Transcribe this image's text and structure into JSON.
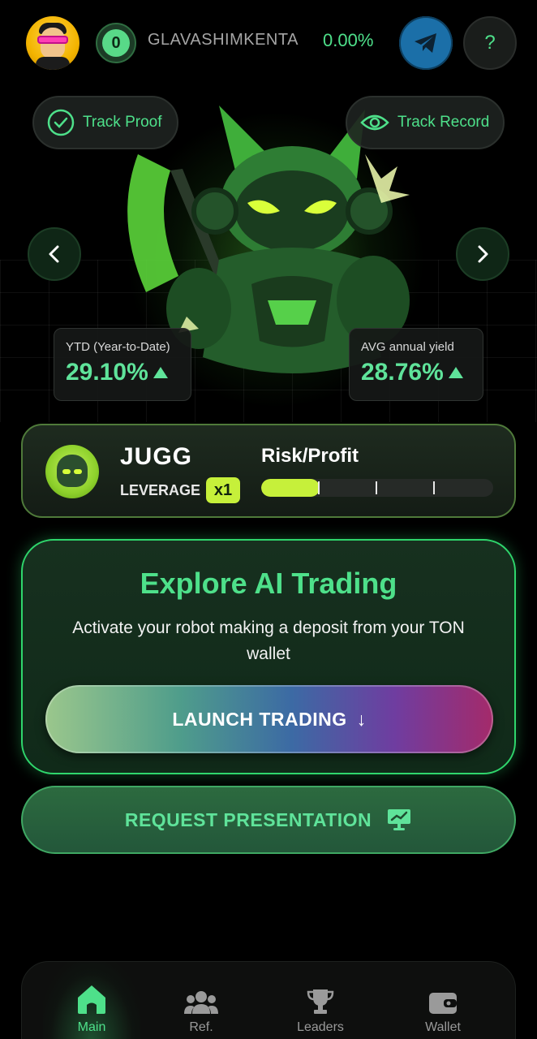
{
  "header": {
    "level": "0",
    "username": "GLAVASHIMKENTA",
    "pnl": "0.00%",
    "icons": {
      "avatar": "user-avatar",
      "telegram": "telegram-icon",
      "help": "help-icon"
    },
    "help_label": "?"
  },
  "hero": {
    "track_proof": "Track Proof",
    "track_record": "Track Record",
    "ytd_label": "YTD (Year-to-Date)",
    "ytd_value": "29.10%",
    "avg_label": "AVG annual yield",
    "avg_value": "28.76%"
  },
  "bot": {
    "name": "JUGG",
    "leverage_label": "LEVERAGE",
    "leverage_value": "x1",
    "risk_label": "Risk/Profit",
    "risk_level": 0.25
  },
  "explore": {
    "title": "Explore AI Trading",
    "subtitle": "Activate your robot making a deposit from your TON wallet",
    "launch_label": "LAUNCH TRADING",
    "launch_arrow": "↓"
  },
  "request": {
    "label": "REQUEST PRESENTATION"
  },
  "nav": {
    "items": [
      {
        "label": "Main",
        "icon": "home-icon",
        "active": true
      },
      {
        "label": "Ref.",
        "icon": "users-icon"
      },
      {
        "label": "Leaders",
        "icon": "trophy-icon"
      },
      {
        "label": "Wallet",
        "icon": "wallet-icon"
      }
    ]
  },
  "colors": {
    "accent": "#4ee08a",
    "lime": "#c6f03a",
    "telegram": "#1b6fa8"
  }
}
